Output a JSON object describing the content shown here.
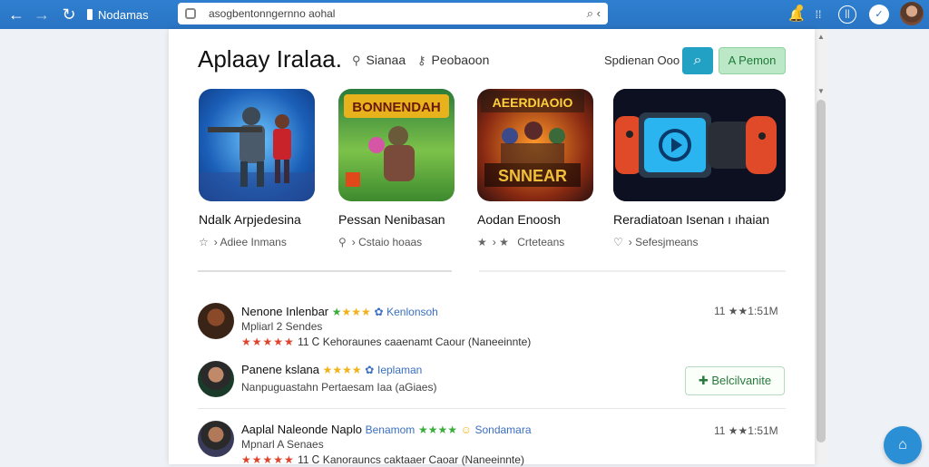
{
  "browser": {
    "tab_title": "Nodamas",
    "url": "asogbentonngernno aohal",
    "icons": [
      "back-arrow-icon",
      "forward-arrow-icon",
      "reload-icon",
      "lock-icon",
      "search-icon",
      "bell-icon",
      "grid-icon",
      "record-icon",
      "shield-icon",
      "avatar"
    ]
  },
  "header": {
    "title": "Aplaay Iralaa.",
    "nav": [
      {
        "label": "Sianaa",
        "icon": "search-icon"
      },
      {
        "label": "Peobaoon",
        "icon": "key-icon"
      }
    ],
    "search_label": "Spdienan Ooo",
    "cta_label": "A Pemon"
  },
  "cards": [
    {
      "name": "Ndalk Arpjedesina",
      "meta": "Adiee Inmans",
      "meta_icon": "star-icon"
    },
    {
      "name": "Pessan Nenibasan",
      "meta": "Cstaio hoaas",
      "meta_icon": "pin-icon"
    },
    {
      "name": "Aodan Enoosh",
      "meta": "Crteteans",
      "meta_icon": "star-icon"
    },
    {
      "name": "Reradiatoan Isenan ı ıhaian",
      "meta": "Sefesjmeans",
      "meta_icon": "heart-icon"
    }
  ],
  "card_art": {
    "c1": {
      "label": ""
    },
    "c2": {
      "label": "BONNENDAH"
    },
    "c3": {
      "top": "AEERDIAOIO",
      "bottom": "SNNEAR"
    }
  },
  "reviews": [
    {
      "name": "Nenone Inlenbar",
      "stars_color": "green",
      "tag": "Kenlonsoh",
      "sub": "Mpliarl 2 Sendes",
      "line": "★★★★★ 11 Ꮯ Kehoraunes caaenamt Caour (Naneeinnte)",
      "time": "11 ★★1:51M"
    },
    {
      "name": "Panene kslana",
      "stars_color": "yellow",
      "tag": "Ieplaman",
      "sub": "Nanpuguastahn Pertaesam Iaa (aGiaes)",
      "button": "Belcilvanite"
    },
    {
      "name": "Aaplal Naleonde Naplo",
      "tag": "Benamom",
      "tag2": "Sondamara",
      "sub": "Mpnarl A Senaes",
      "line": "★★★★★ 11 Ꮯ Kanorauncs caktaaer Caoar (Naneeinnte)",
      "time": "11 ★★1:51M"
    }
  ]
}
